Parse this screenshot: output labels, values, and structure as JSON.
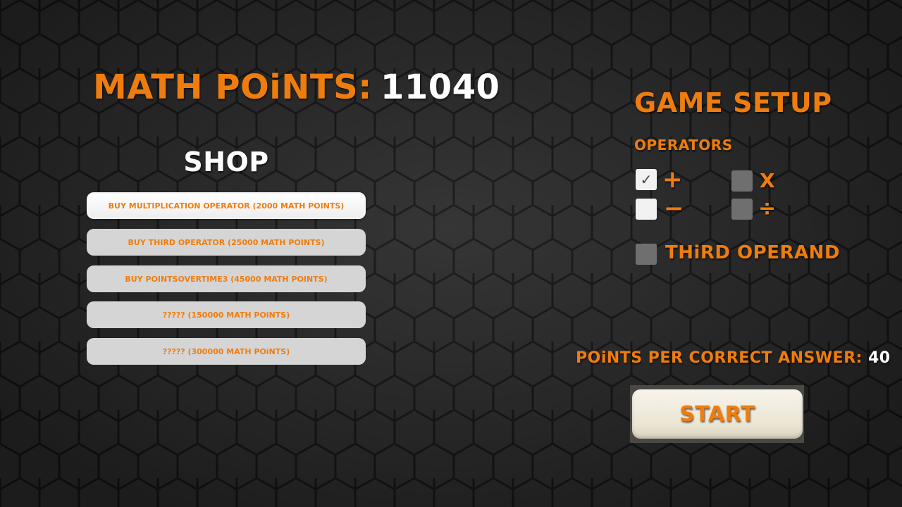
{
  "points": {
    "label": "MATH POiNTS:",
    "value": "11040"
  },
  "shop": {
    "title": "SHOP",
    "items": [
      {
        "label": "BUY MULTIPLICATION OPERATOR (2000 MATH POINTS)"
      },
      {
        "label": "BUY THIRD OPERATOR (25000 MATH POINTS)"
      },
      {
        "label": "BUY POINTSOVERTIME3 (45000 MATH POINTS)"
      },
      {
        "label": "????? (150000 MATH POiNTS)"
      },
      {
        "label": "????? (300000 MATH POiNTS)"
      }
    ]
  },
  "setup": {
    "title": "GAME SETUP",
    "operators_label": "OPERATORS",
    "operators": {
      "plus": {
        "symbol": "+",
        "checked": true,
        "enabled": true,
        "check_glyph": "✓"
      },
      "minus": {
        "symbol": "−",
        "checked": false,
        "enabled": true
      },
      "multiply": {
        "symbol": "X",
        "checked": false,
        "enabled": false
      },
      "divide": {
        "symbol": "÷",
        "checked": false,
        "enabled": false
      }
    },
    "third_operand": {
      "label": "THiRD OPERAND",
      "checked": false,
      "enabled": false
    }
  },
  "points_per_answer": {
    "label": "POiNTS PER CORRECT ANSWER:",
    "value": "40"
  },
  "start": {
    "label": "START"
  },
  "colors": {
    "accent": "#ef7d0e",
    "text_white": "#ffffff",
    "button_bg": "#d5d5d5"
  }
}
